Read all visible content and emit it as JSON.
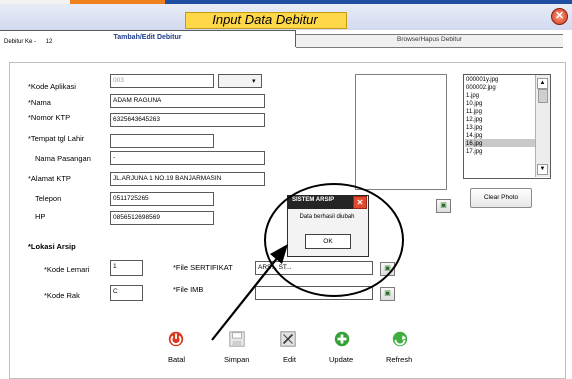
{
  "window": {
    "title": "Input Data Debitur"
  },
  "tabs": [
    {
      "label": "Tambah/Edit Debitur"
    },
    {
      "label": "Browse/Hapus Debitur"
    }
  ],
  "debitur_ke": {
    "label": "Debitur Ke -",
    "value": "12"
  },
  "form": {
    "kode_aplikasi": {
      "label": "*Kode Aplikasi",
      "value": "003"
    },
    "nama": {
      "label": "*Nama",
      "value": "ADAM RAGUNA"
    },
    "nomor_ktp": {
      "label": "*Nomor KTP",
      "value": "6325643645263"
    },
    "tempat_tgl_lahir": {
      "label": "*Tempat tgl Lahir",
      "value": ""
    },
    "nama_pasangan": {
      "label": "Nama Pasangan",
      "value": "-"
    },
    "alamat_ktp": {
      "label": "*Alamat KTP",
      "value": "JL.ARJUNA 1 NO.19 BANJARMASIN"
    },
    "telepon": {
      "label": "Telepon",
      "value": "0511725265"
    },
    "hp": {
      "label": "HP",
      "value": "0856512698569"
    }
  },
  "lokasi_arsip": {
    "heading": "*Lokasi Arsip",
    "kode_lemari": {
      "label": "*Kode Lemari",
      "value": "1"
    },
    "kode_rak": {
      "label": "*Kode Rak",
      "value": "C"
    },
    "file_sertifikat": {
      "label": "*File SERTIFIKAT",
      "value": "ARS... ST..."
    },
    "file_imb": {
      "label": "*File IMB",
      "value": ""
    }
  },
  "photo_files": [
    "000001y.jpg",
    "000002.jpg",
    "1.jpg",
    "10.jpg",
    "11.jpg",
    "12.jpg",
    "13.jpg",
    "14.jpg",
    "16.jpg",
    "17.jpg"
  ],
  "selected_photo": "13.jpg",
  "clear_photo_label": "Clear Photo",
  "dialog": {
    "title": "SISTEM ARSIP",
    "message": "Data berhasil diubah",
    "ok_label": "OK"
  },
  "toolbar": [
    {
      "label": "Batal",
      "icon": "cancel-icon"
    },
    {
      "label": "Simpan",
      "icon": "save-icon"
    },
    {
      "label": "Edit",
      "icon": "edit-icon"
    },
    {
      "label": "Update",
      "icon": "update-icon"
    },
    {
      "label": "Refresh",
      "icon": "refresh-icon"
    }
  ],
  "colors": {
    "title_bar": "#ffd84a",
    "tab_text": "#1e3e8c",
    "dialog_title": "#252525",
    "close": "#d2371c"
  }
}
